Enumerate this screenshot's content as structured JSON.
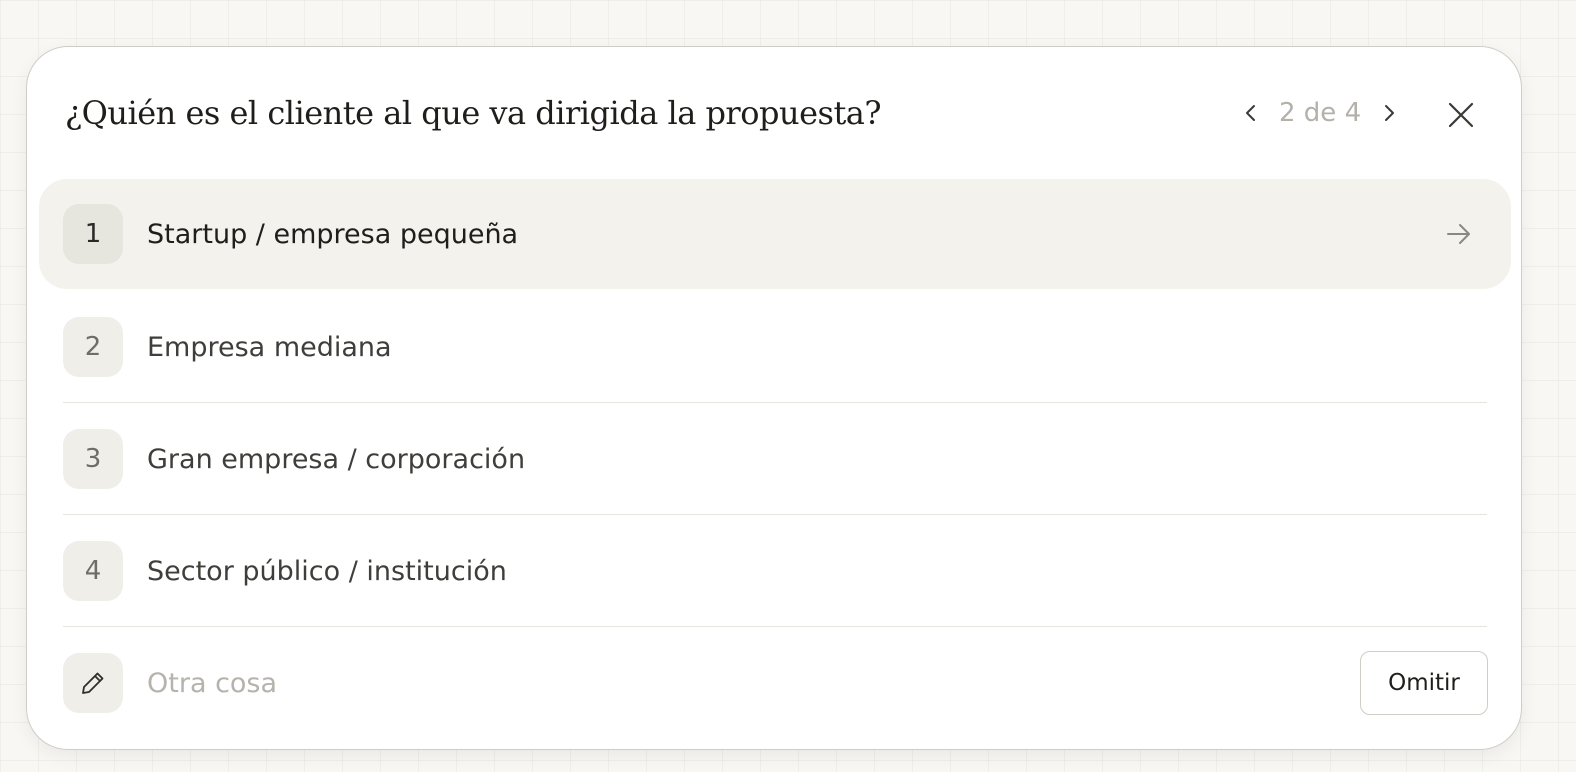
{
  "question": "¿Quién es el cliente al que va dirigida la propuesta?",
  "pager": {
    "text": "2 de 4",
    "prev_icon": "chevron-left-icon",
    "next_icon": "chevron-right-icon"
  },
  "close_icon": "close-icon",
  "options": [
    {
      "number": "1",
      "label": "Startup / empresa pequeña",
      "selected": true
    },
    {
      "number": "2",
      "label": "Empresa mediana",
      "selected": false
    },
    {
      "number": "3",
      "label": "Gran empresa / corporación",
      "selected": false
    },
    {
      "number": "4",
      "label": "Sector público / institución",
      "selected": false
    }
  ],
  "other": {
    "icon": "pencil-icon",
    "placeholder": "Otra cosa",
    "value": ""
  },
  "skip_label": "Omitir",
  "colors": {
    "selected_row_bg": "#f3f2ed",
    "number_badge_bg": "#efeee8",
    "muted_text": "#b3b1aa",
    "primary_text": "#1f1e1b"
  }
}
